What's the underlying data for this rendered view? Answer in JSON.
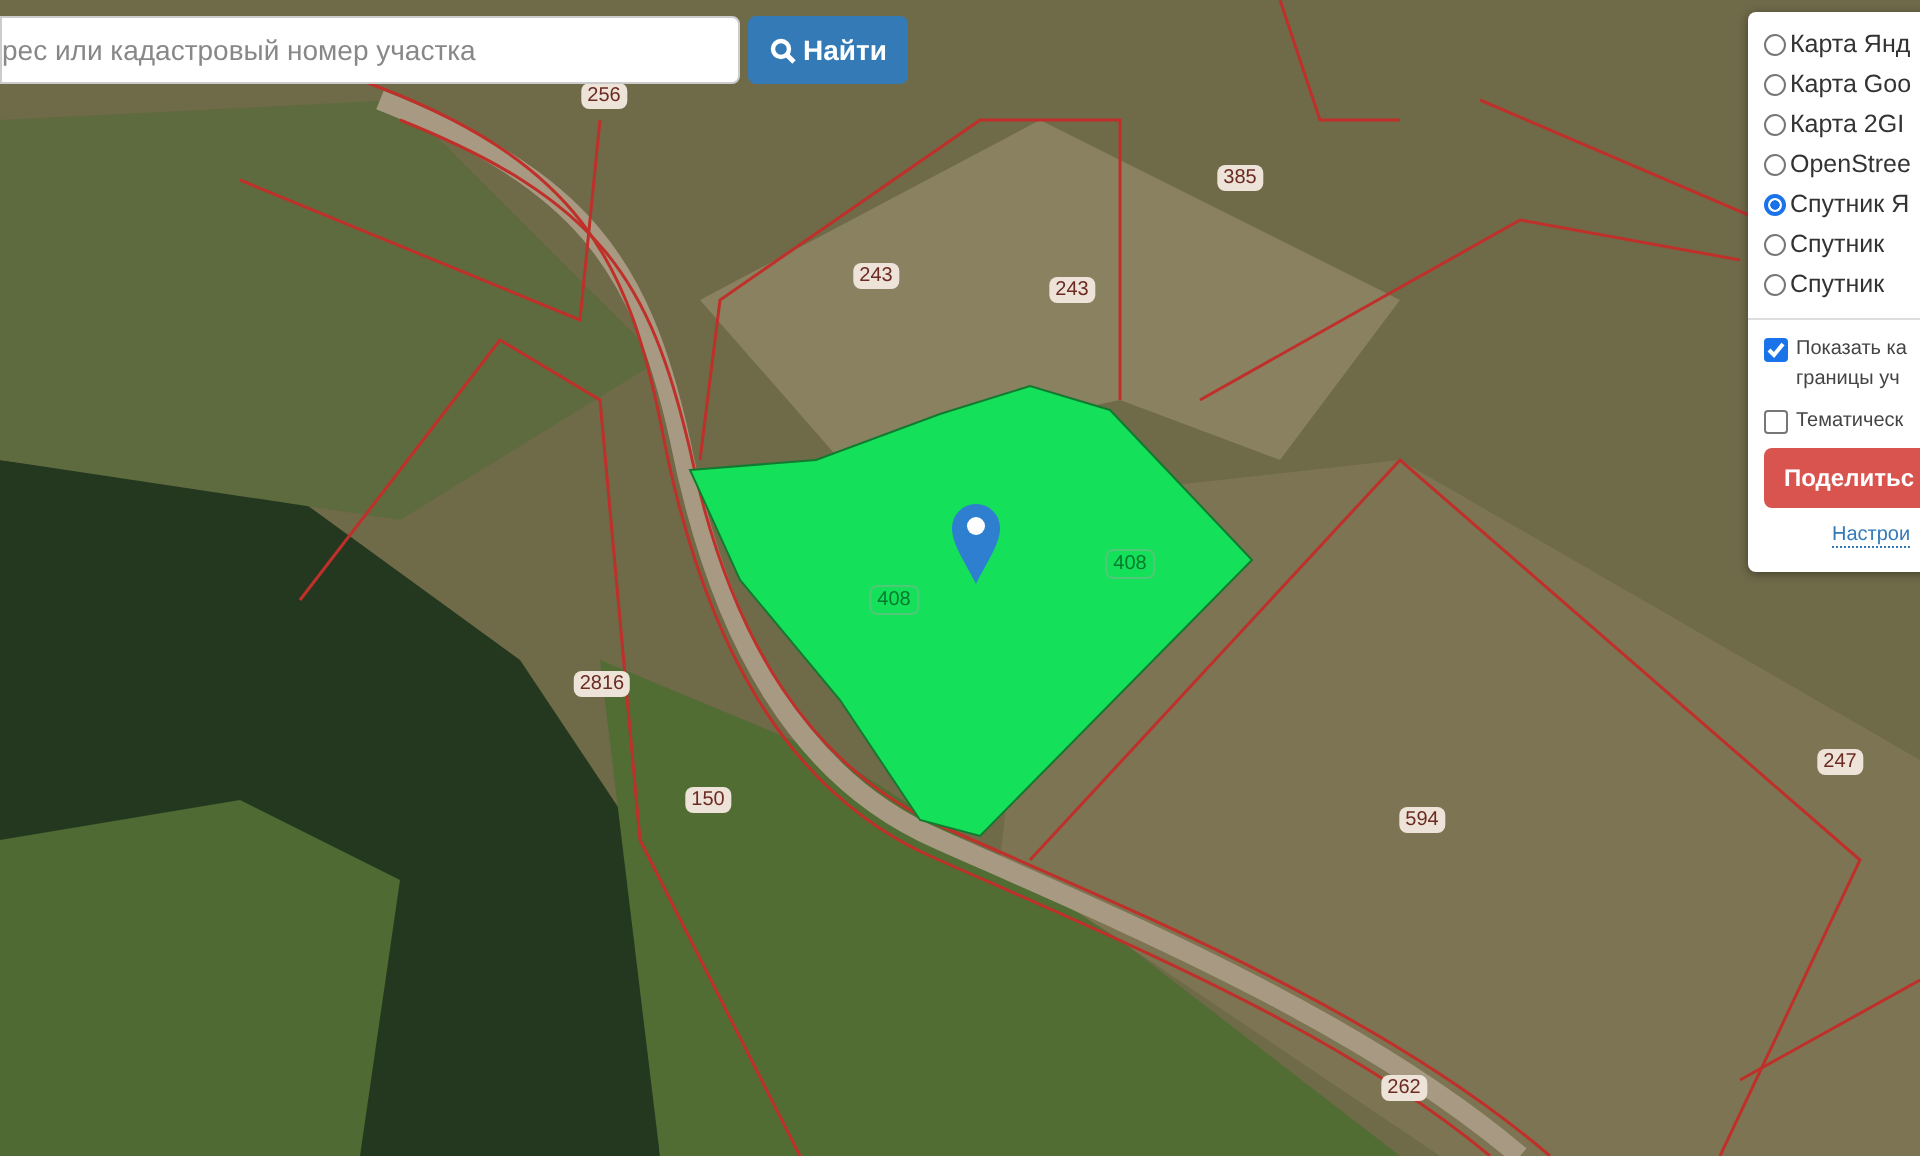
{
  "search": {
    "placeholder": "рес или кадастровый номер участка",
    "button": "Найти"
  },
  "map": {
    "parcel_labels": [
      "256",
      "385",
      "243",
      "243",
      "408",
      "408",
      "2816",
      "150",
      "594",
      "247",
      "262"
    ]
  },
  "layers_panel": {
    "options": [
      {
        "label": "Карта Янд",
        "selected": false
      },
      {
        "label": "Карта Goo",
        "selected": false
      },
      {
        "label": "Карта 2GI",
        "selected": false
      },
      {
        "label": "OpenStree",
        "selected": false
      },
      {
        "label": "Спутник Я",
        "selected": true
      },
      {
        "label": "Спутник",
        "selected": false
      },
      {
        "label": "Спутник",
        "selected": false
      }
    ],
    "checkboxes": [
      {
        "lines": [
          "Показать ка",
          "границы уч"
        ],
        "checked": true
      },
      {
        "lines": [
          "Тематическ"
        ],
        "checked": false
      }
    ],
    "share_button": "Поделитьс",
    "settings_link": "Настрои"
  }
}
